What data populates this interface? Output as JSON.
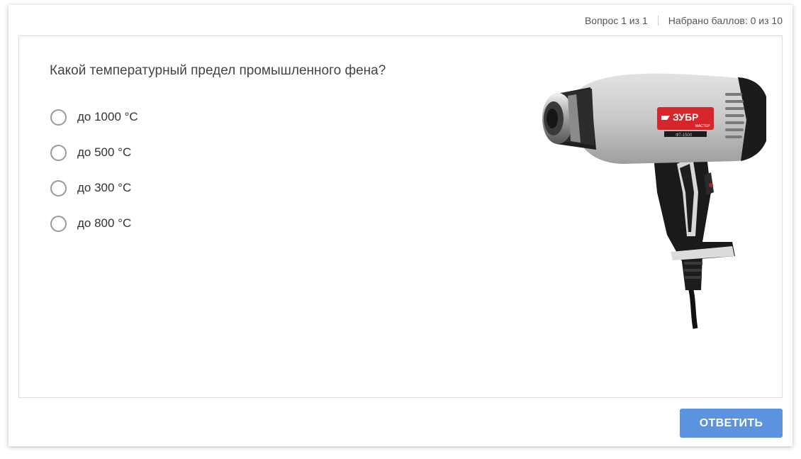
{
  "header": {
    "question_counter": "Вопрос 1 из 1",
    "score": "Набрано баллов: 0 из 10"
  },
  "question": {
    "text": "Какой температурный предел промышленного фена?",
    "answers": [
      {
        "label": "до 1000 °C",
        "selected": false
      },
      {
        "label": "до 500 °C",
        "selected": false
      },
      {
        "label": "до 300 °C",
        "selected": false
      },
      {
        "label": "до 800 °C",
        "selected": false
      }
    ],
    "image": {
      "subject": "heat-gun",
      "brand_logo_text": "ЗУБР",
      "brand_subtext": "МАСТЕР",
      "model_text": "ФТ-1500"
    }
  },
  "footer": {
    "submit_label": "ОТВЕТИТЬ"
  },
  "colors": {
    "accent": "#5b93e0",
    "radio_border": "#9a9a9a",
    "panel_border": "#dcdcdc",
    "brand_red": "#d6262b"
  }
}
